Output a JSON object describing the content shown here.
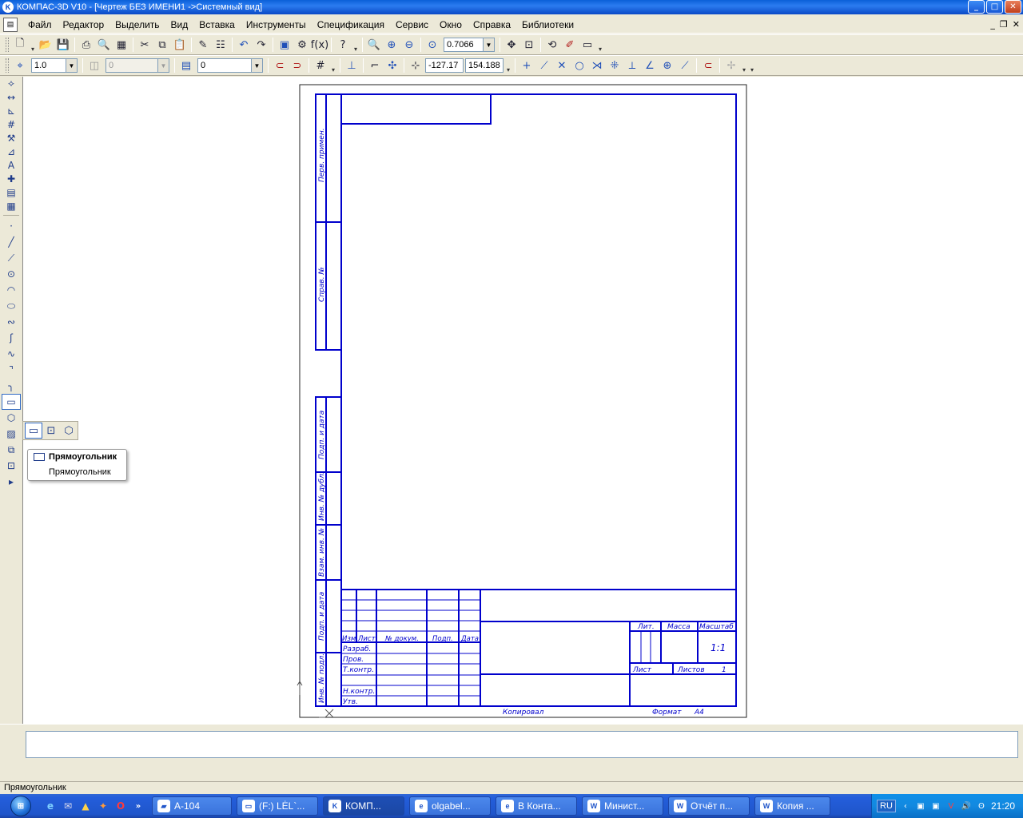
{
  "window": {
    "title": "КОМПАС-3D V10 - [Чертеж БЕЗ ИМЕНИ1 ->Системный вид]"
  },
  "menu": [
    "Файл",
    "Редактор",
    "Выделить",
    "Вид",
    "Вставка",
    "Инструменты",
    "Спецификация",
    "Сервис",
    "Окно",
    "Справка",
    "Библиотеки"
  ],
  "toolbar1": {
    "zoom_value": "0.7066"
  },
  "toolbar2": {
    "step_value": "1.0",
    "angle_value": "0",
    "layer_value": "0",
    "coord_x": "-127.17",
    "coord_y": "154.188"
  },
  "flyout_tooltip": {
    "title": "Прямоугольник",
    "description": "Прямоугольник"
  },
  "status": {
    "text": "Прямоугольник"
  },
  "sheet": {
    "side_labels": [
      "Перв. примен.",
      "Справ. №",
      "Подп. и дата",
      "Инв. № дубл.",
      "Взам. инв. №",
      "Подп. и дата",
      "Инв. № подл."
    ],
    "header_cols": [
      "Изм.",
      "Лист",
      "№ докум.",
      "Подп.",
      "Дата"
    ],
    "row_labels": [
      "Разраб.",
      "Пров.",
      "Т.контр.",
      "Н.контр.",
      "Утв."
    ],
    "right_headers": [
      "Лит.",
      "Масса",
      "Масштаб"
    ],
    "scale_value": "1:1",
    "sheet_label": "Лист",
    "sheets_label": "Листов",
    "sheets_value": "1",
    "copied_label": "Копировал",
    "format_label": "Формат",
    "format_value": "A4",
    "line_color": "#0000cc"
  },
  "taskbar": {
    "tasks": [
      {
        "label": "A-104",
        "icon": "folder-icon"
      },
      {
        "label": "(F:) LĖL`...",
        "icon": "drive-icon"
      },
      {
        "label": "КОМП...",
        "icon": "kompas-icon"
      },
      {
        "label": "olgabel...",
        "icon": "ie-icon"
      },
      {
        "label": "В Конта...",
        "icon": "ie-icon"
      },
      {
        "label": "Минист...",
        "icon": "word-icon"
      },
      {
        "label": "Отчёт п...",
        "icon": "word-icon"
      },
      {
        "label": "Копия ...",
        "icon": "word-icon"
      }
    ],
    "lang": "RU",
    "clock": "21:20"
  }
}
